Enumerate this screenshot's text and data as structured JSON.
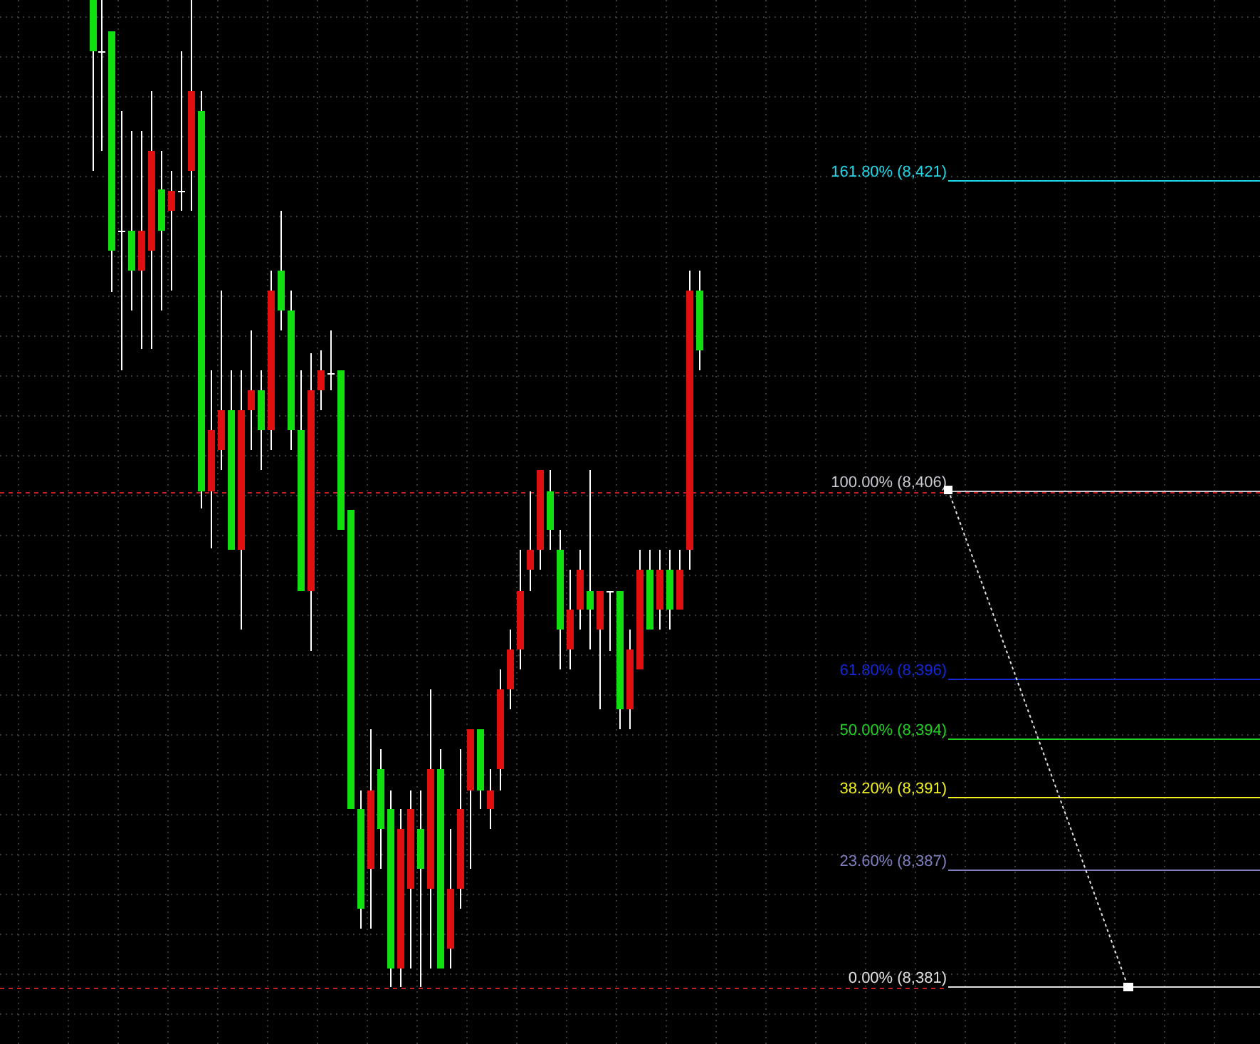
{
  "fibonacci": {
    "levels": [
      {
        "label": "161.80% (8,421)",
        "color": "#20d8e8"
      },
      {
        "label": "100.00% (8,406)",
        "color": "#c8c8d0"
      },
      {
        "label": "61.80% (8,396)",
        "color": "#1428d8"
      },
      {
        "label": "50.00% (8,394)",
        "color": "#20d020"
      },
      {
        "label": "38.20% (8,391)",
        "color": "#f0f020"
      },
      {
        "label": "23.60% (8,387)",
        "color": "#8080c0"
      },
      {
        "label": "0.00% (8,381)",
        "color": "#e0e0e0"
      }
    ]
  }
}
